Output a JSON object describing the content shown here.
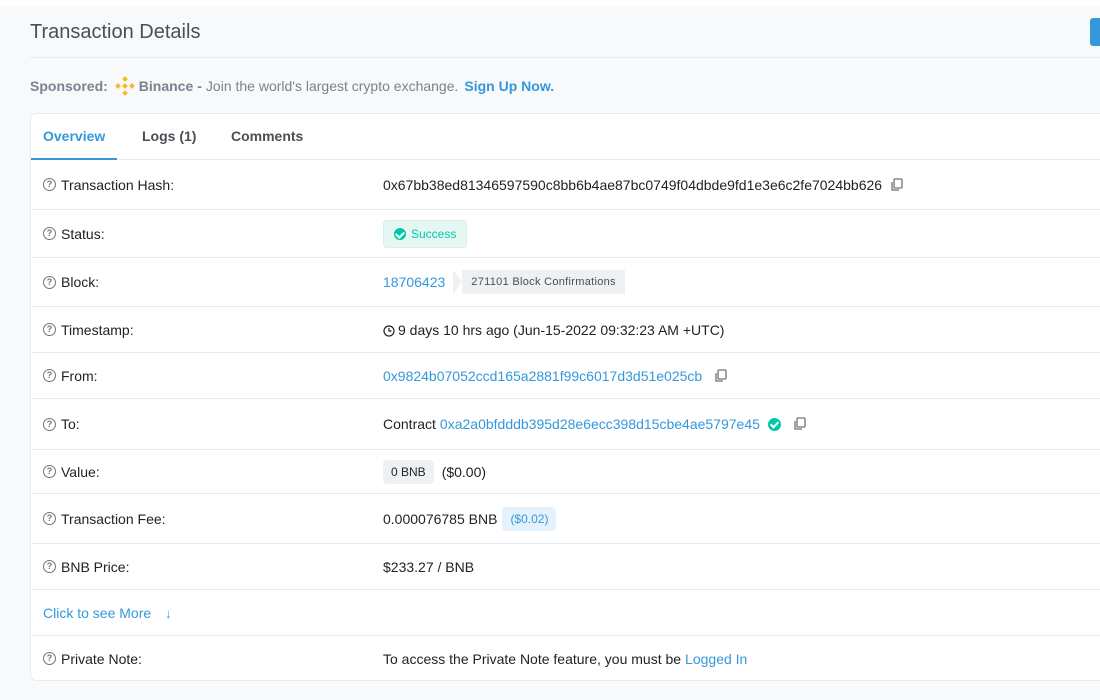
{
  "header": {
    "title": "Transaction Details"
  },
  "sponsored": {
    "label": "Sponsored:",
    "brand": "Binance",
    "dash": "-",
    "description": "Join the world's largest crypto exchange.",
    "cta": "Sign Up Now."
  },
  "tabs": [
    {
      "label": "Overview",
      "active": true
    },
    {
      "label": "Logs (1)",
      "active": false
    },
    {
      "label": "Comments",
      "active": false
    }
  ],
  "rows": {
    "tx_hash": {
      "label": "Transaction Hash:",
      "value": "0x67bb38ed81346597590c8bb6b4ae87bc0749f04dbde9fd1e3e6c2fe7024bb626"
    },
    "status": {
      "label": "Status:",
      "value": "Success"
    },
    "block": {
      "label": "Block:",
      "value": "18706423",
      "confirmations": "271101 Block Confirmations"
    },
    "timestamp": {
      "label": "Timestamp:",
      "value": "9 days 10 hrs ago (Jun-15-2022 09:32:23 AM +UTC)"
    },
    "from": {
      "label": "From:",
      "value": "0x9824b07052ccd165a2881f99c6017d3d51e025cb"
    },
    "to": {
      "label": "To:",
      "prefix": "Contract",
      "value": "0xa2a0bfdddb395d28e6ecc398d15cbe4ae5797e45"
    },
    "value": {
      "label": "Value:",
      "amount": "0 BNB",
      "usd": "($0.00)"
    },
    "fee": {
      "label": "Transaction Fee:",
      "amount": "0.000076785 BNB",
      "usd": "($0.02)"
    },
    "price": {
      "label": "BNB Price:",
      "value": "$233.27 / BNB"
    },
    "note": {
      "label": "Private Note:",
      "text": "To access the Private Note feature, you must be",
      "link": "Logged In"
    }
  },
  "more": {
    "label": "Click to see More",
    "icon": "arrow-down-icon"
  },
  "colors": {
    "accent": "#3498db",
    "success": "#00c9a7",
    "binance": "#f3ba2f"
  }
}
